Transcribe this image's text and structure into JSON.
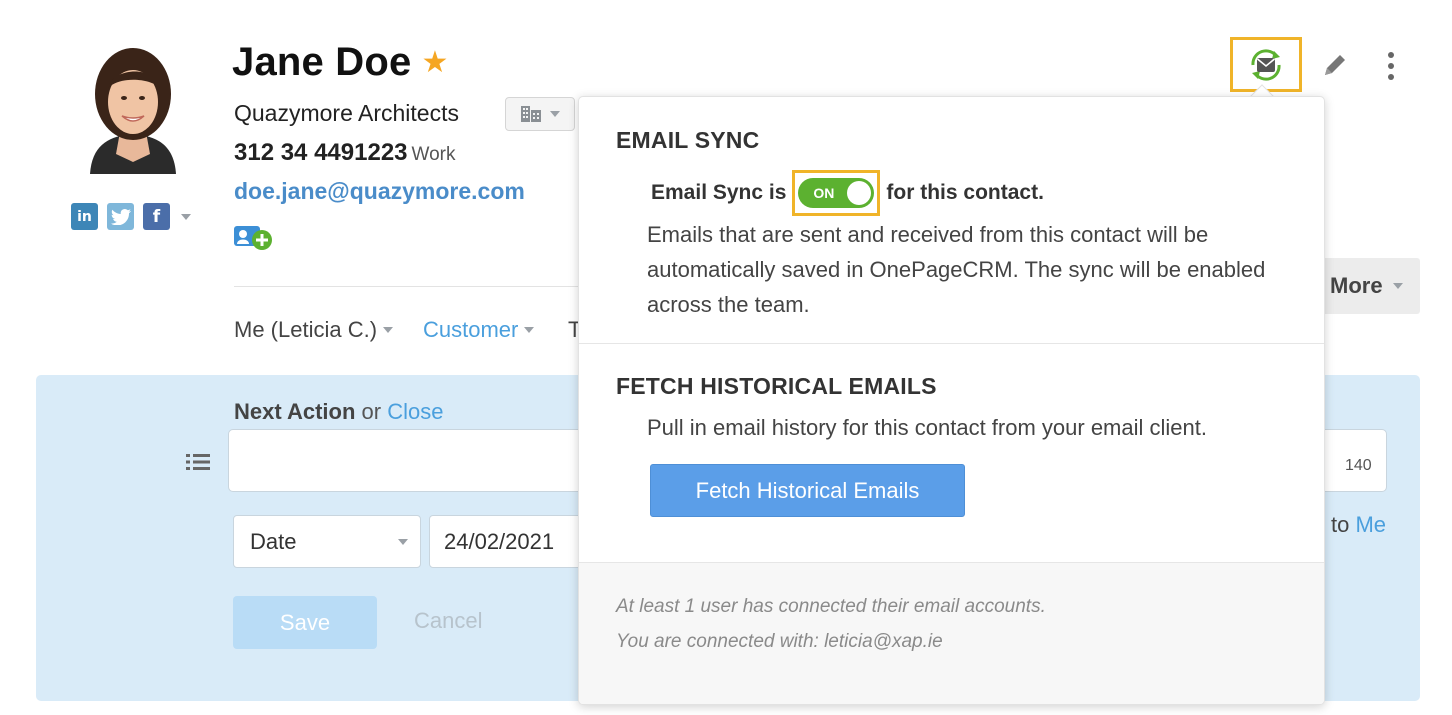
{
  "contact": {
    "name": "Jane Doe",
    "company": "Quazymore Architects",
    "phone": "312 34 4491223",
    "phone_type": "Work",
    "email": "doe.jane@quazymore.com",
    "social": [
      "linkedin-icon",
      "twitter-icon",
      "facebook-icon"
    ]
  },
  "meta": {
    "owner": "Me (Leticia C.)",
    "status": "Customer",
    "tags_partial": "T"
  },
  "toolbar": {
    "more_label": "More"
  },
  "next_action": {
    "title": "Next Action",
    "or": "or",
    "close_link": "Close",
    "char_count": "140",
    "date_type": "Date",
    "date_value": "24/02/2021",
    "assign_prefix": "to",
    "assign_user": "Me",
    "save_label": "Save",
    "cancel_label": "Cancel"
  },
  "popover": {
    "sync_title": "EMAIL SYNC",
    "sync_prefix": "Email Sync is",
    "sync_toggle": "ON",
    "sync_suffix": "for this contact.",
    "sync_desc": "Emails that are sent and received from this contact will be automatically saved in OnePageCRM. The sync will be enabled across the team.",
    "fetch_title": "FETCH HISTORICAL EMAILS",
    "fetch_desc": "Pull in email history for this contact from your email client.",
    "fetch_button": "Fetch Historical Emails",
    "footer_line1": "At least 1 user has connected their email accounts.",
    "footer_line2": "You are connected with: leticia@xap.ie"
  },
  "colors": {
    "accent": "#4a9fdd",
    "highlight": "#f0b429",
    "toggle_on": "#5cb130",
    "star": "#f5a623",
    "panel_bg": "#d9ebf8"
  }
}
